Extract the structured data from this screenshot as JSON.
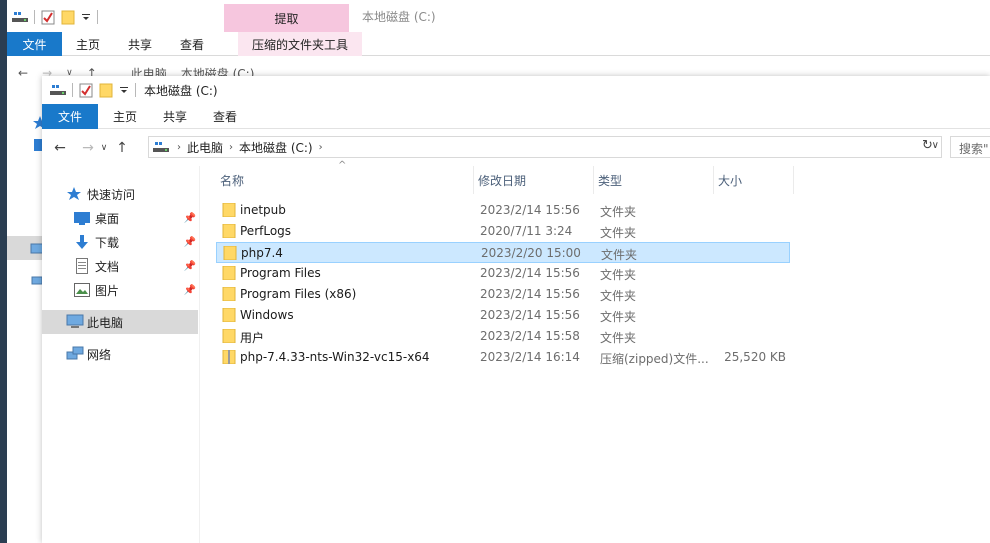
{
  "background_window": {
    "title": "本地磁盘 (C:)",
    "context_tab": "提取",
    "tabs": [
      "文件",
      "主页",
      "共享",
      "查看"
    ],
    "context_tool_tab": "压缩的文件夹工具",
    "breadcrumb": [
      "此电脑",
      "本地磁盘 (C:)"
    ]
  },
  "window": {
    "title": "本地磁盘 (C:)",
    "tabs": {
      "file": "文件",
      "home": "主页",
      "share": "共享",
      "view": "查看"
    },
    "breadcrumb": [
      "此电脑",
      "本地磁盘 (C:)"
    ],
    "search_placeholder": "搜索\""
  },
  "navpane": {
    "quick_access": "快速访问",
    "desktop": "桌面",
    "downloads": "下载",
    "documents": "文档",
    "pictures": "图片",
    "this_pc": "此电脑",
    "network": "网络"
  },
  "columns": {
    "name": "名称",
    "date": "修改日期",
    "type": "类型",
    "size": "大小"
  },
  "files": [
    {
      "name": "inetpub",
      "date": "2023/2/14 15:56",
      "type": "文件夹",
      "size": ""
    },
    {
      "name": "PerfLogs",
      "date": "2020/7/11 3:24",
      "type": "文件夹",
      "size": ""
    },
    {
      "name": "php7.4",
      "date": "2023/2/20 15:00",
      "type": "文件夹",
      "size": ""
    },
    {
      "name": "Program Files",
      "date": "2023/2/14 15:56",
      "type": "文件夹",
      "size": ""
    },
    {
      "name": "Program Files (x86)",
      "date": "2023/2/14 15:56",
      "type": "文件夹",
      "size": ""
    },
    {
      "name": "Windows",
      "date": "2023/2/14 15:56",
      "type": "文件夹",
      "size": ""
    },
    {
      "name": "用户",
      "date": "2023/2/14 15:58",
      "type": "文件夹",
      "size": ""
    },
    {
      "name": "php-7.4.33-nts-Win32-vc15-x64",
      "date": "2023/2/14 16:14",
      "type": "压缩(zipped)文件...",
      "size": "25,520 KB"
    }
  ],
  "selected_file": "php7.4",
  "colors": {
    "accent": "#1979ca",
    "selection": "#cce8ff",
    "context_tab": "#f6c6de",
    "folder": "#ffd866"
  }
}
